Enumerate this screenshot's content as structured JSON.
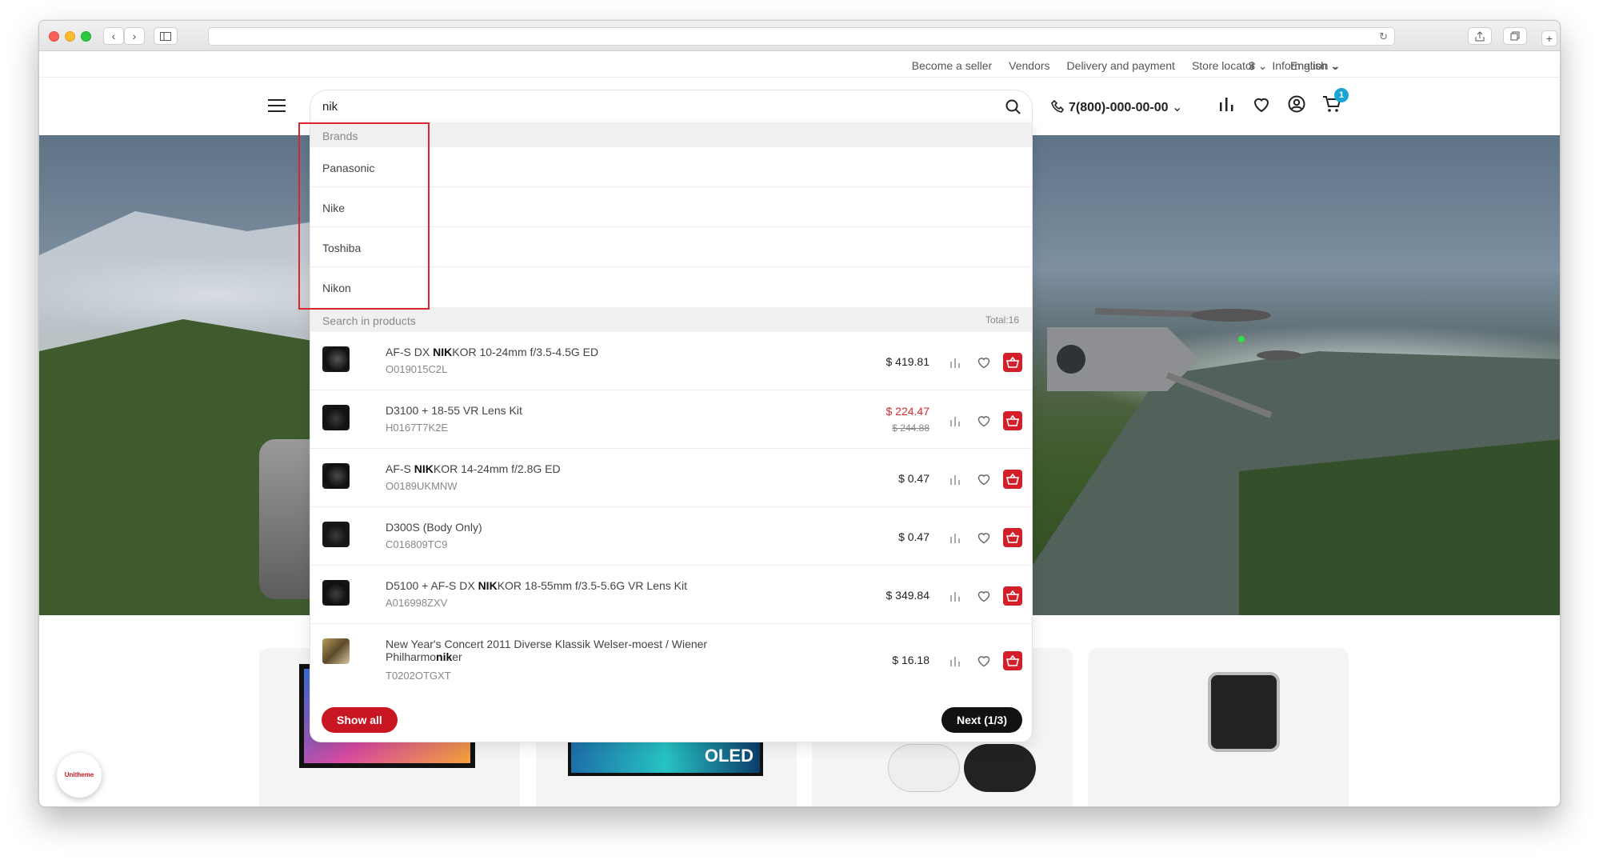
{
  "browser": {
    "nav_back": "‹",
    "nav_forward": "›",
    "reload_icon": "↻"
  },
  "utility_nav": {
    "links": [
      "Become a seller",
      "Vendors",
      "Delivery and payment",
      "Store locator"
    ],
    "information": "Information",
    "currency": "$",
    "language": "English"
  },
  "header": {
    "search_value": "nik",
    "phone": "7(800)-000-00-00",
    "cart_count": "1"
  },
  "dropdown": {
    "brands_heading": "Brands",
    "brands": [
      "Panasonic",
      "Nike",
      "Toshiba",
      "Nikon"
    ],
    "products_heading": "Search in products",
    "total_label": "Total:16",
    "products": [
      {
        "pre": "AF-S DX ",
        "match": "NIK",
        "post": "KOR 10-24mm f/3.5-4.5G ED",
        "sku": "O019015C2L",
        "price": "$ 419.81",
        "old_price": ""
      },
      {
        "pre": "D3100 + 18-55 VR Lens Kit",
        "match": "",
        "post": "",
        "sku": "H0167T7K2E",
        "price": "$ 224.47",
        "old_price": "$ 244.88"
      },
      {
        "pre": "AF-S ",
        "match": "NIK",
        "post": "KOR 14-24mm f/2.8G ED",
        "sku": "O0189UKMNW",
        "price": "$ 0.47",
        "old_price": ""
      },
      {
        "pre": "D300S (Body Only)",
        "match": "",
        "post": "",
        "sku": "C016809TC9",
        "price": "$ 0.47",
        "old_price": ""
      },
      {
        "pre": "D5100 + AF-S DX ",
        "match": "NIK",
        "post": "KOR 18-55mm f/3.5-5.6G VR Lens Kit",
        "sku": "A016998ZXV",
        "price": "$ 349.84",
        "old_price": ""
      },
      {
        "pre": "New Year's Concert 2011 Diverse Klassik Welser-moest / Wiener Philharmo",
        "match": "nik",
        "post": "er",
        "sku": "T0202OTGXT",
        "price": "$ 16.18",
        "old_price": ""
      }
    ],
    "show_all": "Show all",
    "next": "Next (1/3)"
  },
  "hero": {
    "oled_label": "OLED"
  },
  "badge": {
    "brand": "Unitheme"
  },
  "colors": {
    "accent_red": "#c81623",
    "sale_red": "#d42b35",
    "cart_badge": "#1aa3d4"
  }
}
